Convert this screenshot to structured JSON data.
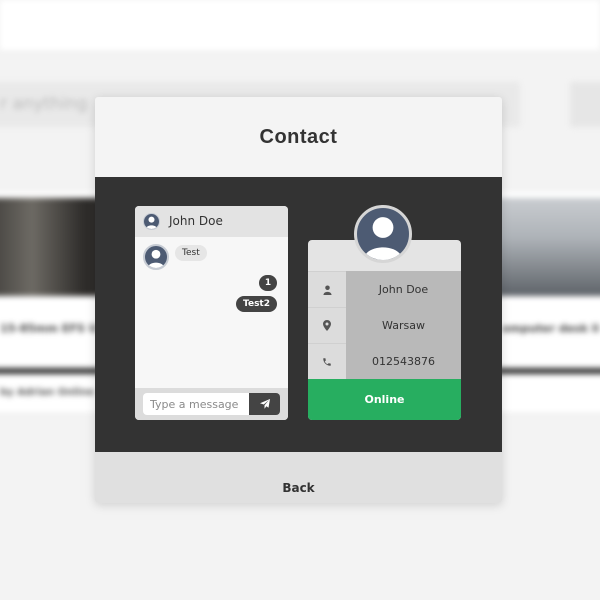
{
  "background": {
    "search_placeholder": "r anything",
    "cards": [
      {
        "title": "15-85mm EFS U",
        "author": "by Adrian Online"
      },
      {
        "title": "omputer desk li"
      }
    ]
  },
  "modal": {
    "title": "Contact",
    "back_label": "Back"
  },
  "chat": {
    "header_name": "John Doe",
    "messages": [
      {
        "direction": "in",
        "text": "Test"
      },
      {
        "direction": "out",
        "text": "1"
      },
      {
        "direction": "out",
        "text": "Test2"
      }
    ],
    "input_placeholder": "Type a message"
  },
  "contact": {
    "name": "John Doe",
    "location": "Warsaw",
    "phone": "012543876",
    "status": "Online",
    "status_color": "#27ae60"
  },
  "icons": {
    "user": "user-icon",
    "location": "map-pin-icon",
    "phone": "phone-icon",
    "send": "paper-plane-icon"
  }
}
